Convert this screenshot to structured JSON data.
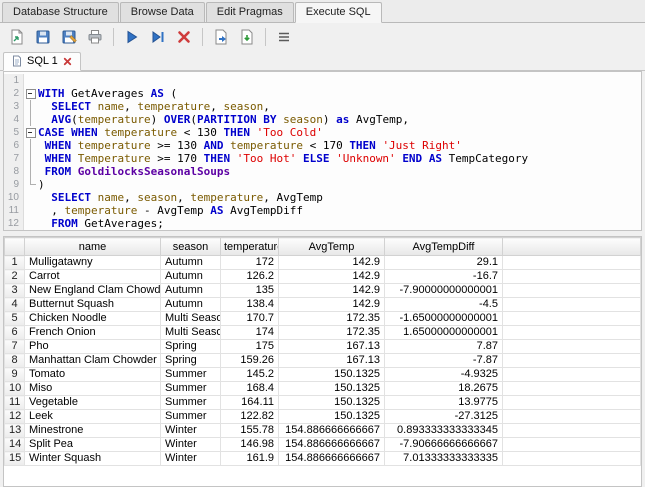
{
  "main_tabs": [
    {
      "label": "Database Structure",
      "active": false
    },
    {
      "label": "Browse Data",
      "active": false
    },
    {
      "label": "Edit Pragmas",
      "active": false
    },
    {
      "label": "Execute SQL",
      "active": true
    }
  ],
  "toolbar": {
    "buttons": [
      {
        "name": "open-sql-file-button",
        "icon": "doc-open"
      },
      {
        "name": "save-sql-file-button",
        "icon": "floppy"
      },
      {
        "name": "save-sql-file-as-button",
        "icon": "floppy-as"
      },
      {
        "name": "print-button",
        "icon": "printer"
      },
      {
        "sep": true
      },
      {
        "name": "execute-all-button",
        "icon": "play"
      },
      {
        "name": "execute-current-line-button",
        "icon": "play-line"
      },
      {
        "name": "stop-button",
        "icon": "stop-cross"
      },
      {
        "sep": true
      },
      {
        "name": "export-results-button",
        "icon": "doc-export"
      },
      {
        "name": "save-results-button",
        "icon": "doc-save"
      },
      {
        "sep": true
      },
      {
        "name": "menu-button",
        "icon": "hamburger"
      }
    ]
  },
  "sql_tab": {
    "label": "SQL 1"
  },
  "syntax_colors": {
    "keyword": "#0000cc",
    "identifier": "#7a5a00",
    "string": "#dd0000",
    "table": "#5c00a3",
    "plain": "#000000"
  },
  "editor": {
    "lines": [
      {
        "n": 1,
        "fold": "",
        "segs": []
      },
      {
        "n": 2,
        "fold": "minus",
        "segs": [
          [
            "kw",
            "WITH"
          ],
          [
            "pl",
            " GetAverages "
          ],
          [
            "kw",
            "AS"
          ],
          [
            "pl",
            " ("
          ]
        ]
      },
      {
        "n": 3,
        "fold": "v",
        "segs": [
          [
            "pl",
            "  "
          ],
          [
            "kw",
            "SELECT"
          ],
          [
            "pl",
            " "
          ],
          [
            "id",
            "name"
          ],
          [
            "pl",
            ", "
          ],
          [
            "id",
            "temperature"
          ],
          [
            "pl",
            ", "
          ],
          [
            "id",
            "season"
          ],
          [
            "pl",
            ","
          ]
        ]
      },
      {
        "n": 4,
        "fold": "v",
        "segs": [
          [
            "pl",
            "  "
          ],
          [
            "kw",
            "AVG"
          ],
          [
            "pl",
            "("
          ],
          [
            "id",
            "temperature"
          ],
          [
            "pl",
            ") "
          ],
          [
            "kw",
            "OVER"
          ],
          [
            "pl",
            "("
          ],
          [
            "kw",
            "PARTITION"
          ],
          [
            "pl",
            " "
          ],
          [
            "kw",
            "BY"
          ],
          [
            "pl",
            " "
          ],
          [
            "id",
            "season"
          ],
          [
            "pl",
            ") "
          ],
          [
            "kw",
            "as"
          ],
          [
            "pl",
            " AvgTemp,"
          ]
        ]
      },
      {
        "n": 5,
        "fold": "minus",
        "segs": [
          [
            "kw",
            "CASE"
          ],
          [
            "pl",
            " "
          ],
          [
            "kw",
            "WHEN"
          ],
          [
            "pl",
            " "
          ],
          [
            "id",
            "temperature"
          ],
          [
            "pl",
            " < 130 "
          ],
          [
            "kw",
            "THEN"
          ],
          [
            "pl",
            " "
          ],
          [
            "str",
            "'Too Cold'"
          ]
        ]
      },
      {
        "n": 6,
        "fold": "v",
        "segs": [
          [
            "pl",
            " "
          ],
          [
            "kw",
            "WHEN"
          ],
          [
            "pl",
            " "
          ],
          [
            "id",
            "temperature"
          ],
          [
            "pl",
            " >= 130 "
          ],
          [
            "kw",
            "AND"
          ],
          [
            "pl",
            " "
          ],
          [
            "id",
            "temperature"
          ],
          [
            "pl",
            " < 170 "
          ],
          [
            "kw",
            "THEN"
          ],
          [
            "pl",
            " "
          ],
          [
            "str",
            "'Just Right'"
          ]
        ]
      },
      {
        "n": 7,
        "fold": "v",
        "segs": [
          [
            "pl",
            " "
          ],
          [
            "kw",
            "WHEN"
          ],
          [
            "pl",
            " "
          ],
          [
            "id",
            "Temperature"
          ],
          [
            "pl",
            " >= 170 "
          ],
          [
            "kw",
            "THEN"
          ],
          [
            "pl",
            " "
          ],
          [
            "str",
            "'Too Hot'"
          ],
          [
            "pl",
            " "
          ],
          [
            "kw",
            "ELSE"
          ],
          [
            "pl",
            " "
          ],
          [
            "str",
            "'Unknown'"
          ],
          [
            "pl",
            " "
          ],
          [
            "kw",
            "END"
          ],
          [
            "pl",
            " "
          ],
          [
            "kw",
            "AS"
          ],
          [
            "pl",
            " TempCategory"
          ]
        ]
      },
      {
        "n": 8,
        "fold": "v",
        "segs": [
          [
            "pl",
            " "
          ],
          [
            "kw",
            "FROM"
          ],
          [
            "pl",
            " "
          ],
          [
            "tbl",
            "GoldilocksSeasonalSoups"
          ]
        ]
      },
      {
        "n": 9,
        "fold": "corner",
        "segs": [
          [
            "pl",
            ")"
          ]
        ]
      },
      {
        "n": 10,
        "fold": "",
        "segs": [
          [
            "pl",
            "  "
          ],
          [
            "kw",
            "SELECT"
          ],
          [
            "pl",
            " "
          ],
          [
            "id",
            "name"
          ],
          [
            "pl",
            ", "
          ],
          [
            "id",
            "season"
          ],
          [
            "pl",
            ", "
          ],
          [
            "id",
            "temperature"
          ],
          [
            "pl",
            ", AvgTemp"
          ]
        ]
      },
      {
        "n": 11,
        "fold": "",
        "segs": [
          [
            "pl",
            "  , "
          ],
          [
            "id",
            "temperature"
          ],
          [
            "pl",
            " - AvgTemp "
          ],
          [
            "kw",
            "AS"
          ],
          [
            "pl",
            " AvgTempDiff"
          ]
        ]
      },
      {
        "n": 12,
        "fold": "",
        "segs": [
          [
            "pl",
            "  "
          ],
          [
            "kw",
            "FROM"
          ],
          [
            "pl",
            " GetAverages;"
          ]
        ]
      }
    ]
  },
  "results": {
    "columns": [
      {
        "label": "name",
        "align": "left",
        "width": 136
      },
      {
        "label": "season",
        "align": "left",
        "width": 60
      },
      {
        "label": "temperature",
        "align": "right",
        "width": 58
      },
      {
        "label": "AvgTemp",
        "align": "right",
        "width": 106
      },
      {
        "label": "AvgTempDiff",
        "align": "right",
        "width": 118
      }
    ],
    "rows": [
      [
        "Mulligatawny",
        "Autumn",
        "172",
        "142.9",
        "29.1"
      ],
      [
        "Carrot",
        "Autumn",
        "126.2",
        "142.9",
        "-16.7"
      ],
      [
        "New England Clam Chowder",
        "Autumn",
        "135",
        "142.9",
        "-7.90000000000001"
      ],
      [
        "Butternut Squash",
        "Autumn",
        "138.4",
        "142.9",
        "-4.5"
      ],
      [
        "Chicken Noodle",
        "Multi Season",
        "170.7",
        "172.35",
        "-1.65000000000001"
      ],
      [
        "French Onion",
        "Multi Season",
        "174",
        "172.35",
        "1.65000000000001"
      ],
      [
        "Pho",
        "Spring",
        "175",
        "167.13",
        "7.87"
      ],
      [
        "Manhattan Clam Chowder",
        "Spring",
        "159.26",
        "167.13",
        "-7.87"
      ],
      [
        "Tomato",
        "Summer",
        "145.2",
        "150.1325",
        "-4.9325"
      ],
      [
        "Miso",
        "Summer",
        "168.4",
        "150.1325",
        "18.2675"
      ],
      [
        "Vegetable",
        "Summer",
        "164.11",
        "150.1325",
        "13.9775"
      ],
      [
        "Leek",
        "Summer",
        "122.82",
        "150.1325",
        "-27.3125"
      ],
      [
        "Minestrone",
        "Winter",
        "155.78",
        "154.886666666667",
        "0.893333333333345"
      ],
      [
        "Split Pea",
        "Winter",
        "146.98",
        "154.886666666667",
        "-7.90666666666667"
      ],
      [
        "Winter Squash",
        "Winter",
        "161.9",
        "154.886666666667",
        "7.01333333333335"
      ]
    ]
  }
}
